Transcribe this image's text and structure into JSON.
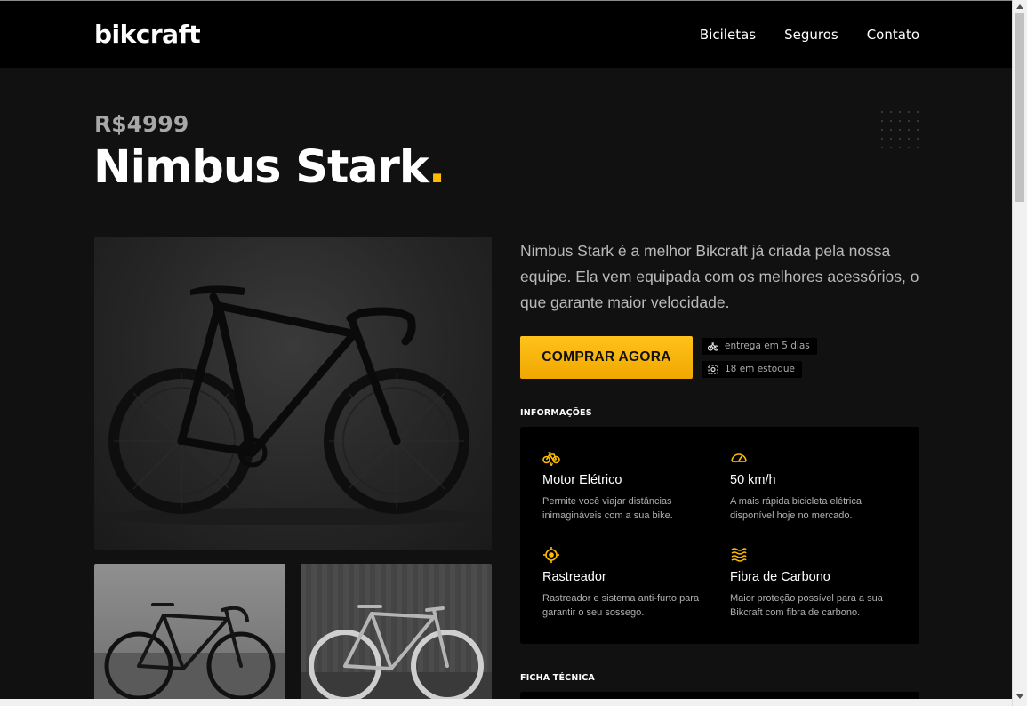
{
  "header": {
    "logo": "bikcraft",
    "nav": [
      "Biciletas",
      "Seguros",
      "Contato"
    ]
  },
  "product": {
    "price": "R$4999",
    "name": "Nimbus Stark",
    "name_dot": ".",
    "description": "Nimbus Stark é a melhor Bikcraft já criada pela nossa equipe. Ela vem equipada com os melhores acessórios, o que garante maior velocidade.",
    "buy_label": "COMPRAR AGORA",
    "tags": [
      "entrega em 5 dias",
      "18 em estoque"
    ]
  },
  "info": {
    "label": "INFORMAÇÕES",
    "features": [
      {
        "icon": "electric-bike-icon",
        "title": "Motor Elétrico",
        "text": "Permite você viajar distâncias inimagináveis com a sua bike."
      },
      {
        "icon": "speedometer-icon",
        "title": "50 km/h",
        "text": "A mais rápida bicicleta elétrica disponível hoje no mercado."
      },
      {
        "icon": "tracker-icon",
        "title": "Rastreador",
        "text": "Rastreador e sistema anti-furto para garantir o seu sossego."
      },
      {
        "icon": "carbon-fiber-icon",
        "title": "Fibra de Carbono",
        "text": "Maior proteção possível para a sua Bikcraft com fibra de carbono."
      }
    ]
  },
  "ficha": {
    "label": "FICHA TÉCNICA"
  },
  "colors": {
    "accent": "#ffbb00",
    "background": "#111111",
    "header": "#000000"
  }
}
